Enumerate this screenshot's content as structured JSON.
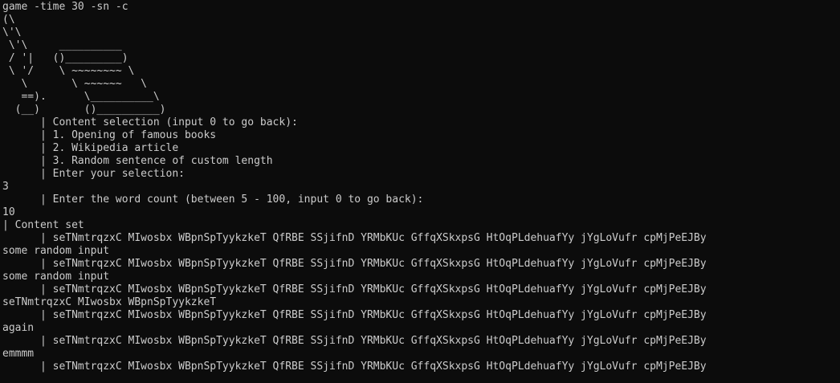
{
  "terminal": {
    "lines": [
      "game -time 30 -sn -c",
      "(\\",
      "\\'\\",
      " \\'\\     __________",
      " / '|   ()_________)",
      " \\ '/    \\ ~~~~~~~~ \\",
      "   \\       \\ ~~~~~~   \\",
      "   ==).      \\__________\\",
      "  (__)       ()__________)",
      "      | Content selection (input 0 to go back):",
      "      | 1. Opening of famous books",
      "      | 2. Wikipedia article",
      "      | 3. Random sentence of custom length",
      "      | Enter your selection:",
      "3",
      "      | Enter the word count (between 5 - 100, input 0 to go back):",
      "10",
      "| Content set",
      "      | seTNmtrqzxC MIwosbx WBpnSpTyykzkeT QfRBE SSjifnD YRMbKUc GffqXSkxpsG HtOqPLdehuafYy jYgLoVufr cpMjPeEJBy",
      "some random input",
      "      | seTNmtrqzxC MIwosbx WBpnSpTyykzkeT QfRBE SSjifnD YRMbKUc GffqXSkxpsG HtOqPLdehuafYy jYgLoVufr cpMjPeEJBy",
      "some random input",
      "      | seTNmtrqzxC MIwosbx WBpnSpTyykzkeT QfRBE SSjifnD YRMbKUc GffqXSkxpsG HtOqPLdehuafYy jYgLoVufr cpMjPeEJBy",
      "seTNmtrqzxC MIwosbx WBpnSpTyykzkeT",
      "      | seTNmtrqzxC MIwosbx WBpnSpTyykzkeT QfRBE SSjifnD YRMbKUc GffqXSkxpsG HtOqPLdehuafYy jYgLoVufr cpMjPeEJBy",
      "again",
      "      | seTNmtrqzxC MIwosbx WBpnSpTyykzkeT QfRBE SSjifnD YRMbKUc GffqXSkxpsG HtOqPLdehuafYy jYgLoVufr cpMjPeEJBy",
      "emmmm",
      "      | seTNmtrqzxC MIwosbx WBpnSpTyykzkeT QfRBE SSjifnD YRMbKUc GffqXSkxpsG HtOqPLdehuafYy jYgLoVufr cpMjPeEJBy"
    ]
  }
}
